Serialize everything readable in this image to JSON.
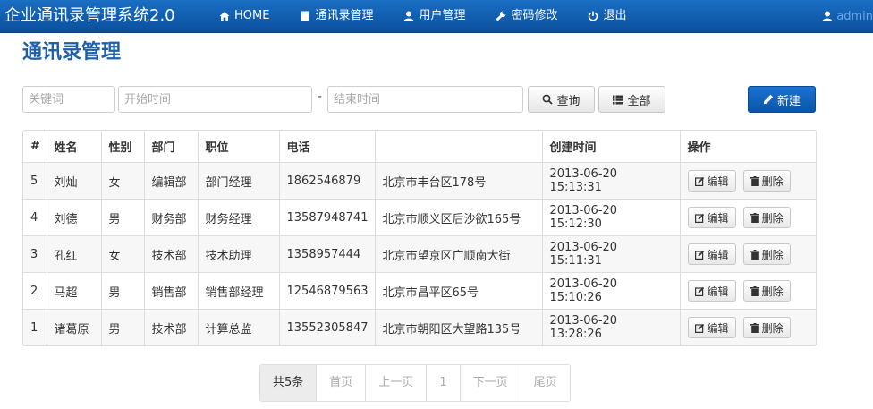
{
  "navbar": {
    "brand": "企业通讯录管理系统2.0",
    "items": [
      {
        "label": "HOME",
        "icon": "home-icon"
      },
      {
        "label": "通讯录管理",
        "icon": "book-icon"
      },
      {
        "label": "用户管理",
        "icon": "user-icon"
      },
      {
        "label": "密码修改",
        "icon": "wrench-icon"
      },
      {
        "label": "退出",
        "icon": "power-icon"
      }
    ],
    "user": "admin"
  },
  "page": {
    "title": "通讯录管理"
  },
  "search": {
    "keyword_placeholder": "关键词",
    "start_placeholder": "开始时间",
    "dash": "-",
    "end_placeholder": "结束时间",
    "query_label": "查询",
    "all_label": "全部",
    "new_label": "新建"
  },
  "table": {
    "headers": [
      "#",
      "姓名",
      "性别",
      "部门",
      "职位",
      "电话",
      "",
      "创建时间",
      "操作"
    ],
    "rows": [
      {
        "id": "5",
        "name": "刘灿",
        "gender": "女",
        "dept": "编辑部",
        "position": "部门经理",
        "phone": "1862546879",
        "address": "北京市丰台区178号",
        "created": "2013-06-20 15:13:31"
      },
      {
        "id": "4",
        "name": "刘德",
        "gender": "男",
        "dept": "财务部",
        "position": "财务经理",
        "phone": "13587948741",
        "address": "北京市顺义区后沙欲165号",
        "created": "2013-06-20 15:12:30"
      },
      {
        "id": "3",
        "name": "孔红",
        "gender": "女",
        "dept": "技术部",
        "position": "技术助理",
        "phone": "1358957444",
        "address": "北京市望京区广顺南大街",
        "created": "2013-06-20 15:11:31"
      },
      {
        "id": "2",
        "name": "马超",
        "gender": "男",
        "dept": "销售部",
        "position": "销售部经理",
        "phone": "12546879563",
        "address": "北京市昌平区65号",
        "created": "2013-06-20 15:10:26"
      },
      {
        "id": "1",
        "name": "诸葛原",
        "gender": "男",
        "dept": "技术部",
        "position": "计算总监",
        "phone": "13552305847",
        "address": "北京市朝阳区大望路135号",
        "created": "2013-06-20 13:28:26"
      }
    ],
    "edit_label": "编辑",
    "delete_label": "删除"
  },
  "pagination": {
    "total": "共5条",
    "first": "首页",
    "prev": "上一页",
    "current": "1",
    "next": "下一页",
    "last": "尾页"
  }
}
